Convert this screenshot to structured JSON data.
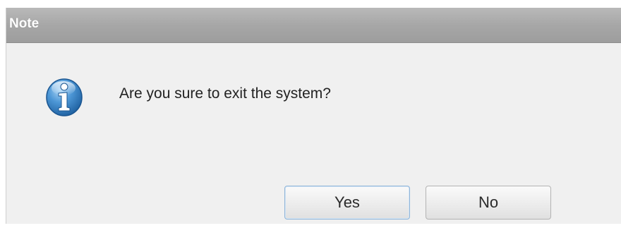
{
  "dialog": {
    "title": "Note",
    "message": "Are you sure to exit the system?",
    "icon": "info-icon",
    "buttons": {
      "yes_label": "Yes",
      "no_label": "No"
    }
  },
  "colors": {
    "titlebar": "#a7a7a7",
    "body_background": "#f0f0f0",
    "icon_blue": "#3a86c8",
    "default_button_border": "#8fb4d8"
  }
}
